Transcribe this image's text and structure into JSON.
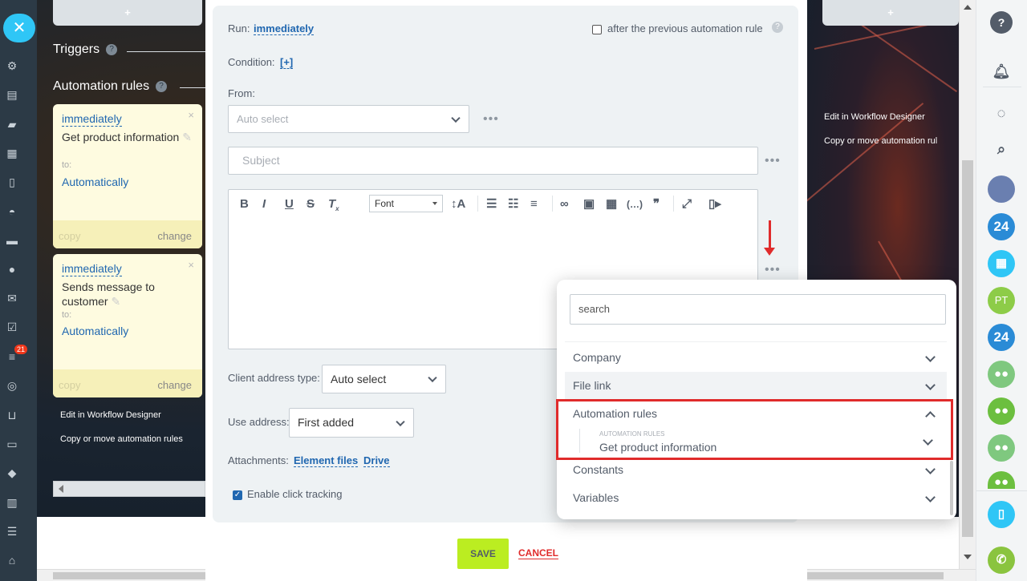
{
  "sidebar": {
    "close_icon": "close-icon",
    "badge_count": "21"
  },
  "column": {
    "add_symbol": "+",
    "triggers_title": "Triggers",
    "rules_title": "Automation rules",
    "help_symbol": "?",
    "cards": [
      {
        "run": "immediately",
        "title": "Get product information",
        "to_label": "to:",
        "to_value": "Automatically",
        "copy": "copy",
        "change": "change",
        "close": "×"
      },
      {
        "run": "immediately",
        "title": "Sends message to customer",
        "to_label": "to:",
        "to_value": "Automatically",
        "copy": "copy",
        "change": "change",
        "close": "×"
      }
    ],
    "link_edit": "Edit in Workflow Designer",
    "link_copy": "Copy or move automation rules"
  },
  "right_column": {
    "add_symbol": "+",
    "link_edit": "Edit in Workflow Designer",
    "link_copy": "Copy or move automation rul"
  },
  "editor": {
    "run_label": "Run:",
    "run_value": "immediately",
    "after_previous": "after the previous automation rule",
    "condition_label": "Condition:",
    "condition_value": "[+]",
    "from_label": "From:",
    "from_value": "Auto select",
    "subject_placeholder": "Subject",
    "font_label": "Font",
    "client_address_type_label": "Client address type:",
    "client_address_type_value": "Auto select",
    "use_address_label": "Use address:",
    "use_address_value": "First added",
    "attachments_label": "Attachments:",
    "attachment_element_files": "Element files",
    "attachment_drive": "Drive",
    "click_tracking": "Enable click tracking",
    "more": "•••"
  },
  "popup": {
    "search_placeholder": "search",
    "items": [
      "Company",
      "File link",
      "Automation rules",
      "Constants",
      "Variables"
    ],
    "sub_caption": "AUTOMATION RULES",
    "sub_value": "Get product information"
  },
  "actions": {
    "save": "SAVE",
    "cancel": "CANCEL"
  },
  "rightbar": {
    "help": "?",
    "avatar_initials": "PT",
    "b24": "24"
  },
  "colors": {
    "accent": "#2067b0",
    "save_green": "#bbed21",
    "highlight_red": "#e02b2b",
    "close_blue": "#2fc6f6"
  }
}
